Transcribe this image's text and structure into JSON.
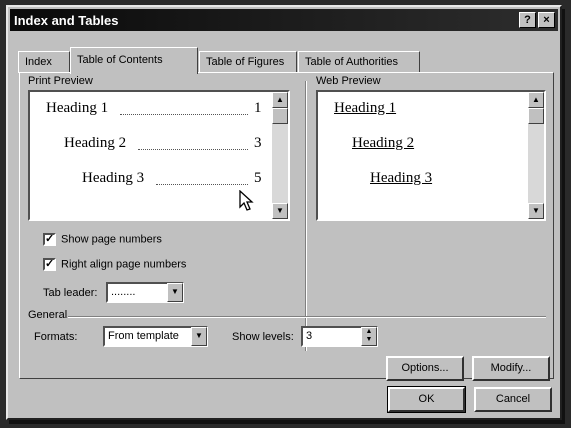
{
  "window": {
    "title": "Index and Tables",
    "help_button": "?",
    "close_button": "×"
  },
  "tabs": [
    {
      "label": "Index",
      "active": false
    },
    {
      "label": "Table of Contents",
      "active": true
    },
    {
      "label": "Table of Figures",
      "active": false
    },
    {
      "label": "Table of Authorities",
      "active": false
    }
  ],
  "print_preview": {
    "label": "Print Preview",
    "lines": [
      {
        "text": "Heading 1",
        "page": "1"
      },
      {
        "text": "Heading 2",
        "page": "3"
      },
      {
        "text": "Heading 3",
        "page": "5"
      }
    ]
  },
  "web_preview": {
    "label": "Web Preview",
    "lines": [
      "Heading 1",
      "Heading 2",
      "Heading 3"
    ]
  },
  "options": {
    "show_page_numbers": {
      "label": "Show page numbers",
      "checked": true
    },
    "right_align": {
      "label": "Right align page numbers",
      "checked": true
    },
    "tab_leader": {
      "label": "Tab leader:",
      "value": "........"
    }
  },
  "general": {
    "label": "General",
    "formats": {
      "label": "Formats:",
      "value": "From template"
    },
    "show_levels": {
      "label": "Show levels:",
      "value": "3"
    }
  },
  "buttons": {
    "options": "Options...",
    "modify": "Modify...",
    "ok": "OK",
    "cancel": "Cancel"
  }
}
